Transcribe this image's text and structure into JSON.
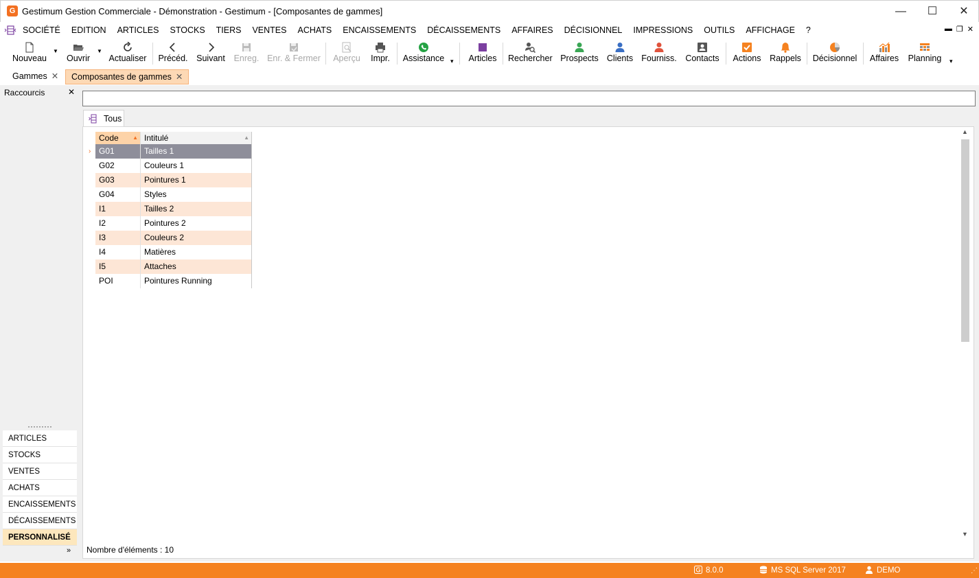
{
  "window": {
    "title": "Gestimum Gestion Commerciale - Démonstration - Gestimum - [Composantes de gammes]",
    "app_icon_letter": "G",
    "min_glyph": "—",
    "max_glyph": "☐",
    "close_glyph": "✕"
  },
  "menu": {
    "items": [
      "SOCIÉTÉ",
      "EDITION",
      "ARTICLES",
      "STOCKS",
      "TIERS",
      "VENTES",
      "ACHATS",
      "ENCAISSEMENTS",
      "DÉCAISSEMENTS",
      "AFFAIRES",
      "DÉCISIONNEL",
      "IMPRESSIONS",
      "OUTILS",
      "AFFICHAGE",
      "?"
    ],
    "mdi_min": "▬",
    "mdi_restore": "❐",
    "mdi_close": "✕"
  },
  "toolbar": {
    "nouveau": "Nouveau",
    "ouvrir": "Ouvrir",
    "actualiser": "Actualiser",
    "preced": "Précéd.",
    "suivant": "Suivant",
    "enreg": "Enreg.",
    "enr_fermer": "Enr. & Fermer",
    "apercu": "Aperçu",
    "impr": "Impr.",
    "assistance": "Assistance",
    "articles": "Articles",
    "rechercher": "Rechercher",
    "prospects": "Prospects",
    "clients": "Clients",
    "fourniss": "Fourniss.",
    "contacts": "Contacts",
    "actions": "Actions",
    "rappels": "Rappels",
    "decisionnel": "Décisionnel",
    "affaires": "Affaires",
    "planning": "Planning"
  },
  "icon_colors": {
    "green": "#3aa655",
    "blue": "#3a6fc4",
    "red": "#e0533d",
    "orange": "#f58220",
    "purple": "#7b3fa0",
    "gray": "#555555",
    "whatsapp": "#25a244"
  },
  "doc_tabs": [
    {
      "label": "Gammes"
    },
    {
      "label": "Composantes de gammes"
    }
  ],
  "left_panel": {
    "title": "Raccourcis",
    "dots": "·········",
    "sections": [
      "ARTICLES",
      "STOCKS",
      "VENTES",
      "ACHATS",
      "ENCAISSEMENTS",
      "DÉCAISSEMENTS",
      "PERSONNALISÉ"
    ],
    "active_section": "PERSONNALISÉ",
    "more": "»"
  },
  "main": {
    "search_value": "",
    "view_tab": "Tous"
  },
  "grid": {
    "columns": [
      "Code",
      "Intitulé"
    ],
    "rows": [
      {
        "code": "G01",
        "intitule": "Tailles 1"
      },
      {
        "code": "G02",
        "intitule": "Couleurs 1"
      },
      {
        "code": "G03",
        "intitule": "Pointures 1"
      },
      {
        "code": "G04",
        "intitule": "Styles"
      },
      {
        "code": "I1",
        "intitule": "Tailles 2"
      },
      {
        "code": "I2",
        "intitule": "Pointures 2"
      },
      {
        "code": "I3",
        "intitule": "Couleurs 2"
      },
      {
        "code": "I4",
        "intitule": "Matières"
      },
      {
        "code": "I5",
        "intitule": "Attaches"
      },
      {
        "code": "POI",
        "intitule": "Pointures Running"
      }
    ],
    "selected_index": 0,
    "count_text": "Nombre d'éléments : 10"
  },
  "status": {
    "version": "8.0.0",
    "database": "MS SQL Server 2017",
    "user": "DEMO"
  }
}
